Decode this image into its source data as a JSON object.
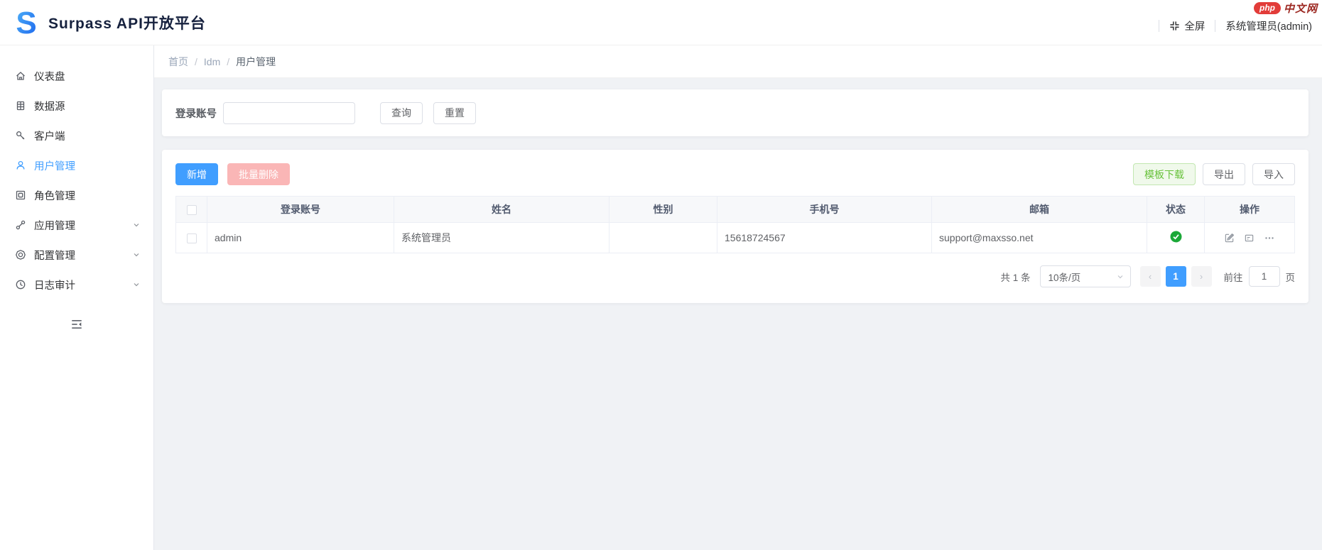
{
  "header": {
    "title": "Surpass API开放平台",
    "logo_letter": "S",
    "watermark": {
      "badge": "php",
      "text": "中文网"
    },
    "fullscreen_label": "全屏",
    "user_label": "系统管理员(admin)"
  },
  "sidebar": {
    "items": [
      {
        "label": "仪表盘",
        "icon": "home-icon",
        "active": false,
        "expandable": false
      },
      {
        "label": "数据源",
        "icon": "datasource-icon",
        "active": false,
        "expandable": false
      },
      {
        "label": "客户端",
        "icon": "key-icon",
        "active": false,
        "expandable": false
      },
      {
        "label": "用户管理",
        "icon": "user-icon",
        "active": true,
        "expandable": false
      },
      {
        "label": "角色管理",
        "icon": "role-icon",
        "active": false,
        "expandable": false
      },
      {
        "label": "应用管理",
        "icon": "app-link-icon",
        "active": false,
        "expandable": true
      },
      {
        "label": "配置管理",
        "icon": "config-icon",
        "active": false,
        "expandable": true
      },
      {
        "label": "日志审计",
        "icon": "log-clock-icon",
        "active": false,
        "expandable": true
      }
    ]
  },
  "breadcrumb": {
    "items": [
      "首页",
      "Idm",
      "用户管理"
    ],
    "separator": "/"
  },
  "search": {
    "label": "登录账号",
    "input_value": "",
    "query_label": "查询",
    "reset_label": "重置"
  },
  "toolbar": {
    "add_label": "新增",
    "batch_delete_label": "批量删除",
    "template_label": "模板下载",
    "export_label": "导出",
    "import_label": "导入"
  },
  "table": {
    "columns": [
      "登录账号",
      "姓名",
      "性别",
      "手机号",
      "邮箱",
      "状态",
      "操作"
    ],
    "rows": [
      {
        "account": "admin",
        "name": "系统管理员",
        "gender": "",
        "phone": "15618724567",
        "email": "support@maxsso.net",
        "status": "enabled"
      }
    ]
  },
  "pagination": {
    "total_text": "共 1 条",
    "page_size": "10条/页",
    "current_page": "1",
    "prev_label": "‹",
    "next_label": "›",
    "goto_label": "前往",
    "goto_value": "1",
    "page_unit": "页"
  },
  "colors": {
    "primary": "#409eff",
    "success_plain": "#67c23a",
    "status_green": "#1ba838",
    "danger_disabled": "#fab6b6",
    "content_bg": "#f0f2f5"
  }
}
